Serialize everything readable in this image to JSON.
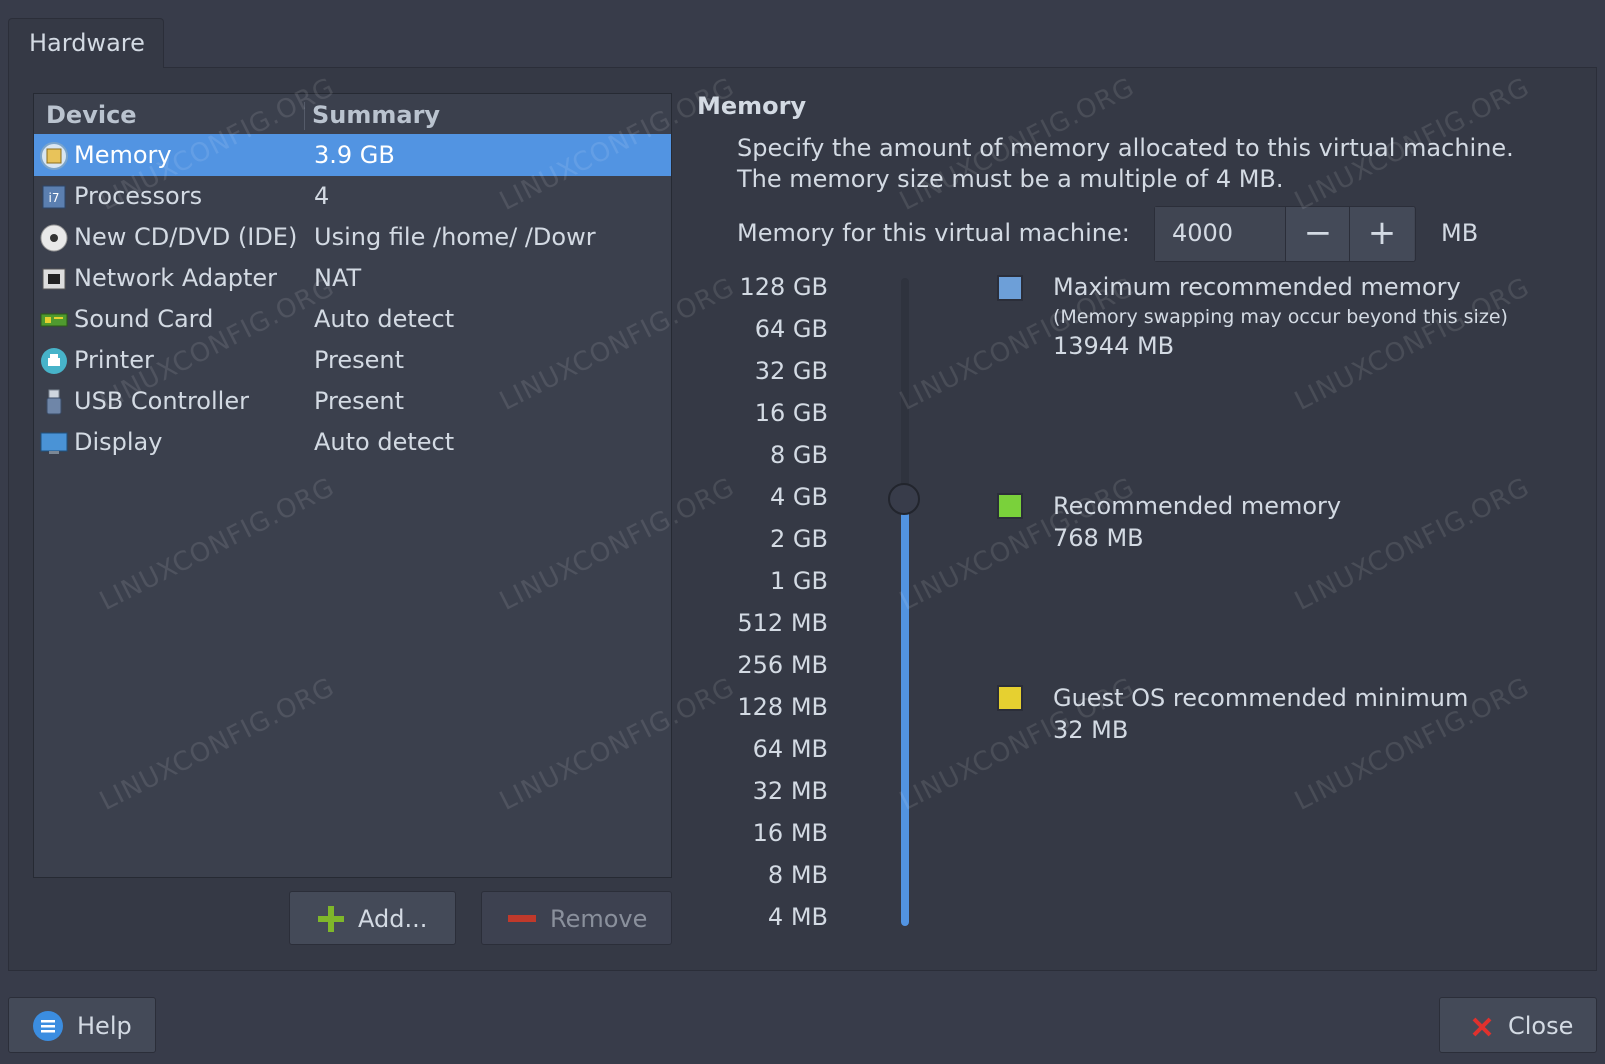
{
  "tab": {
    "label": "Hardware"
  },
  "device_list": {
    "columns": [
      "Device",
      "Summary"
    ],
    "rows": [
      {
        "icon": "memory-chip-icon",
        "device": "Memory",
        "summary": "3.9 GB",
        "selected": true
      },
      {
        "icon": "cpu-icon",
        "device": "Processors",
        "summary": "4"
      },
      {
        "icon": "cd-dvd-icon",
        "device": "New CD/DVD (IDE)",
        "summary": "Using file /home/       /Dowr"
      },
      {
        "icon": "network-adapter-icon",
        "device": "Network Adapter",
        "summary": "NAT"
      },
      {
        "icon": "sound-card-icon",
        "device": "Sound Card",
        "summary": "Auto detect"
      },
      {
        "icon": "printer-icon",
        "device": "Printer",
        "summary": "Present"
      },
      {
        "icon": "usb-icon",
        "device": "USB Controller",
        "summary": "Present"
      },
      {
        "icon": "display-icon",
        "device": "Display",
        "summary": "Auto detect"
      }
    ]
  },
  "actions": {
    "add_label": "Add...",
    "remove_label": "Remove"
  },
  "memory": {
    "title": "Memory",
    "description_line1": "Specify the amount of memory allocated to this virtual machine.",
    "description_line2": "The memory size must be a multiple of 4 MB.",
    "field_label": "Memory for this virtual machine:",
    "value": "4000",
    "decrement_label": "−",
    "increment_label": "+",
    "unit": "MB",
    "scale_labels": [
      "128 GB",
      "64 GB",
      "32 GB",
      "16 GB",
      "8 GB",
      "4 GB",
      "2 GB",
      "1 GB",
      "512 MB",
      "256 MB",
      "128 MB",
      "64 MB",
      "32 MB",
      "16 MB",
      "8 MB",
      "4 MB"
    ],
    "slider_level_label": "4 GB",
    "max_recommended": {
      "title": "Maximum recommended memory",
      "note": "(Memory swapping may occur beyond this size)",
      "value": "13944 MB",
      "color": "#6d9fd8"
    },
    "recommended": {
      "title": "Recommended memory",
      "value": "768 MB",
      "color": "#7ad13b"
    },
    "guest_min": {
      "title": "Guest OS recommended minimum",
      "value": "32 MB",
      "color": "#e6d030"
    }
  },
  "footer": {
    "help_label": "Help",
    "close_label": "Close"
  },
  "watermark": "LINUXCONFIG.ORG",
  "colors": {
    "accent": "#5294e2",
    "background": "#383c4a"
  }
}
